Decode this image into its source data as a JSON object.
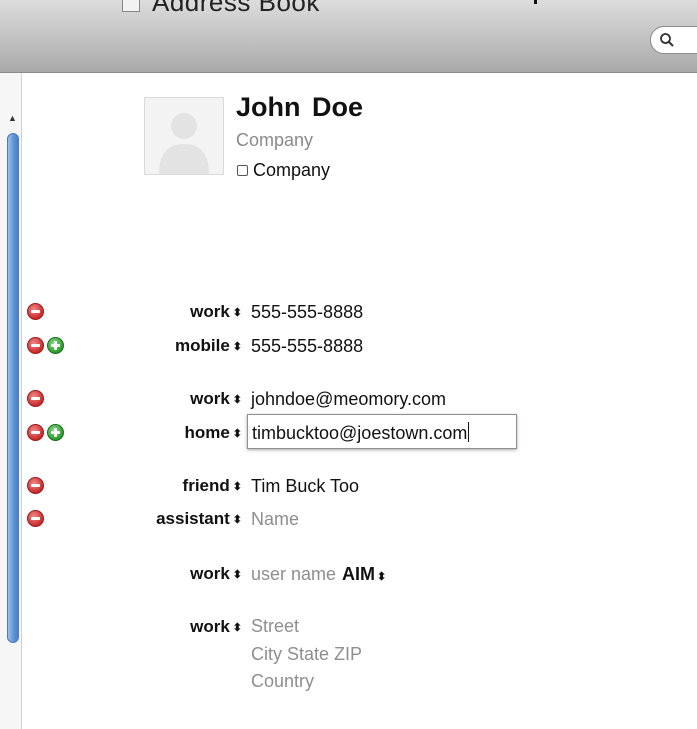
{
  "window": {
    "title": "Address Book"
  },
  "toolbar": {
    "search_icon": "magnifier-icon"
  },
  "contact": {
    "name": "John  Doe",
    "company_placeholder": "Company",
    "company_checkbox_label": "Company"
  },
  "phones": [
    {
      "label": "work",
      "value": "555-555-8888"
    },
    {
      "label": "mobile",
      "value": "555-555-8888"
    }
  ],
  "emails": [
    {
      "label": "work",
      "value": "johndoe@meomory.com"
    },
    {
      "label": "home",
      "value": "timbucktoo@joestown.com"
    }
  ],
  "related": [
    {
      "label": "friend",
      "value": "Tim Buck Too"
    },
    {
      "label": "assistant",
      "placeholder": "Name"
    }
  ],
  "im": {
    "label": "work",
    "placeholder": "user name",
    "service": "AIM"
  },
  "address": {
    "label": "work",
    "street_placeholder": "Street",
    "city_placeholder": "City State ZIP",
    "country_placeholder": "Country"
  },
  "colors": {
    "remove": "#d32f2f",
    "add": "#2e9e2e",
    "selection": "#5d91d6"
  }
}
